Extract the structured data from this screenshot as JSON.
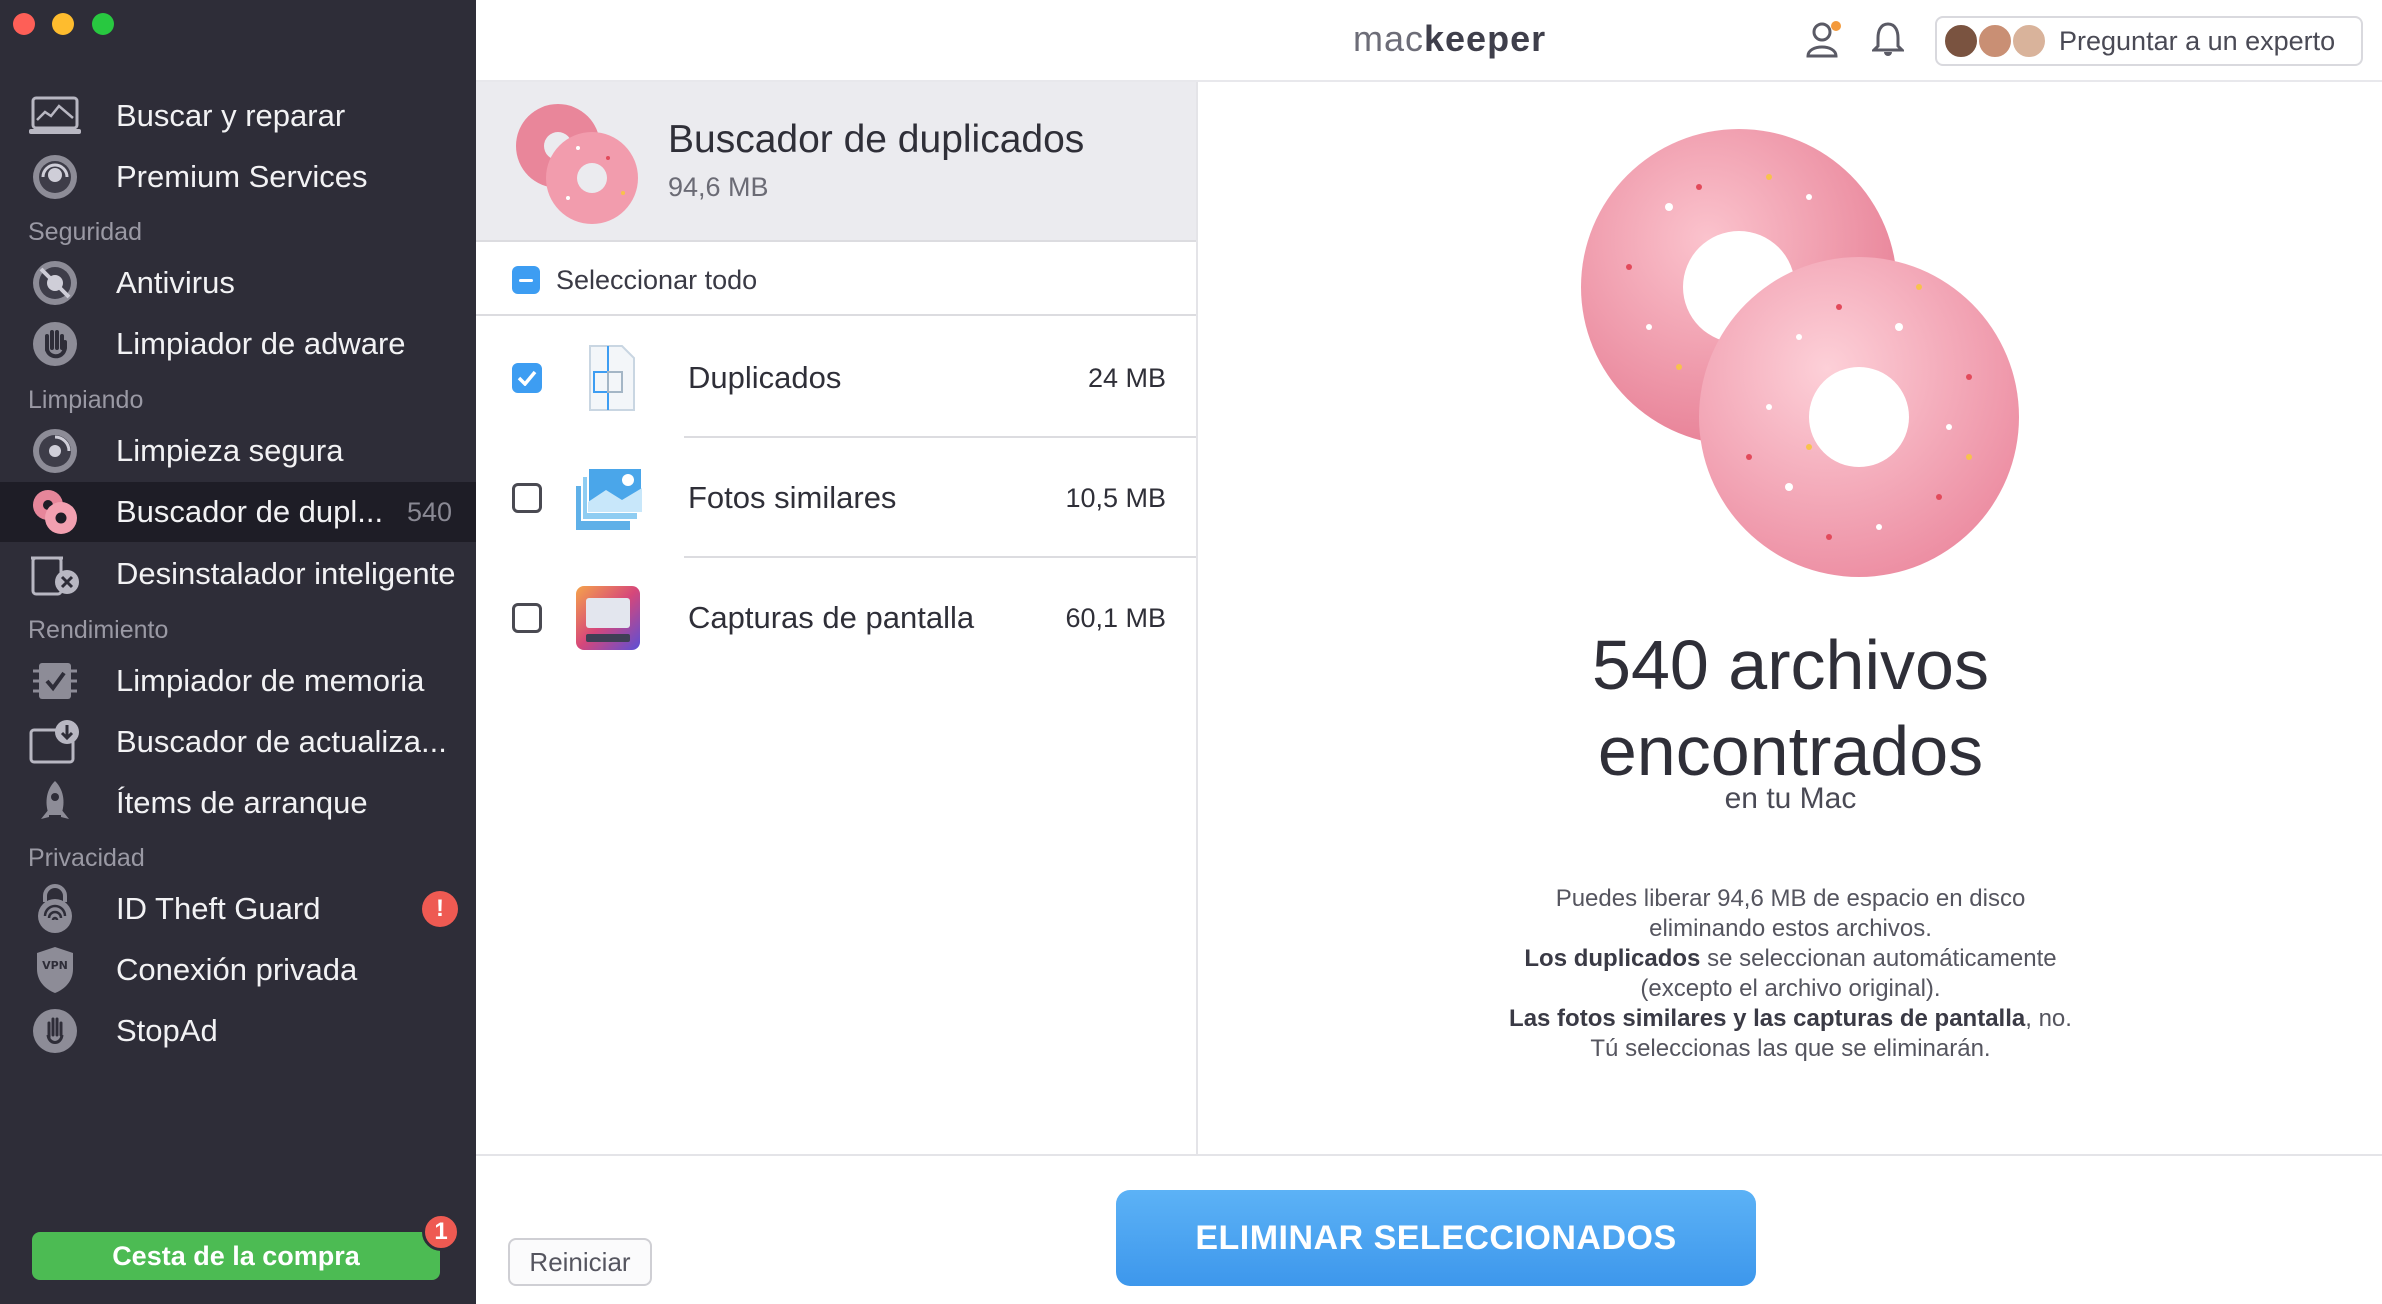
{
  "app": {
    "brand_light": "mac",
    "brand_bold": "keeper",
    "expert_button": "Preguntar a un experto"
  },
  "sidebar": {
    "items": [
      {
        "label": "Buscar y reparar",
        "icon": "laptop-icon"
      },
      {
        "label": "Premium Services",
        "icon": "support-agent-icon"
      },
      {
        "label": "Antivirus",
        "icon": "antivirus-icon"
      },
      {
        "label": "Limpiador de adware",
        "icon": "hand-stop-icon"
      },
      {
        "label": "Limpieza segura",
        "icon": "disk-clean-icon"
      },
      {
        "label": "Buscador de dupl...",
        "icon": "donuts-icon",
        "count": "540"
      },
      {
        "label": "Desinstalador inteligente",
        "icon": "uninstall-icon"
      },
      {
        "label": "Limpiador de memoria",
        "icon": "memory-icon"
      },
      {
        "label": "Buscador de actualiza...",
        "icon": "update-icon"
      },
      {
        "label": "Ítems de arranque",
        "icon": "rocket-icon"
      },
      {
        "label": "ID Theft Guard",
        "icon": "fingerprint-lock-icon",
        "badge": "!"
      },
      {
        "label": "Conexión privada",
        "icon": "vpn-shield-icon"
      },
      {
        "label": "StopAd",
        "icon": "stopad-hand-icon"
      }
    ],
    "sections": [
      "Seguridad",
      "Limpiando",
      "Rendimiento",
      "Privacidad"
    ],
    "cart": {
      "label": "Cesta de la compra",
      "badge": "1"
    }
  },
  "list": {
    "header_title": "Buscador de duplicados",
    "header_size": "94,6 MB",
    "select_all": "Seleccionar todo",
    "rows": [
      {
        "label": "Duplicados",
        "size": "24 MB",
        "checked": true,
        "icon": "duplicate-file-icon"
      },
      {
        "label": "Fotos similares",
        "size": "10,5 MB",
        "checked": false,
        "icon": "similar-photos-icon"
      },
      {
        "label": "Capturas de pantalla",
        "size": "60,1 MB",
        "checked": false,
        "icon": "screenshot-icon"
      }
    ]
  },
  "detail": {
    "count_line1": "540 archivos",
    "count_line2": "encontrados",
    "subtitle": "en tu Mac",
    "desc1": "Puedes liberar 94,6 MB de espacio en disco",
    "desc2": "eliminando estos archivos.",
    "desc3_bold": "Los duplicados",
    "desc3_rest": " se seleccionan automáticamente",
    "desc4": "(excepto el archivo original).",
    "desc5_bold": "Las fotos similares y las capturas de pantalla",
    "desc5_rest": ", no.",
    "desc6": "Tú seleccionas las que se eliminarán."
  },
  "footer": {
    "restart": "Reiniciar",
    "remove": "ELIMINAR SELECCIONADOS"
  },
  "colors": {
    "accent": "#3d9df2",
    "sidebar": "#2e2d38",
    "cart": "#4cbb53",
    "alert": "#ee5a52",
    "donut": "#f0869a"
  }
}
